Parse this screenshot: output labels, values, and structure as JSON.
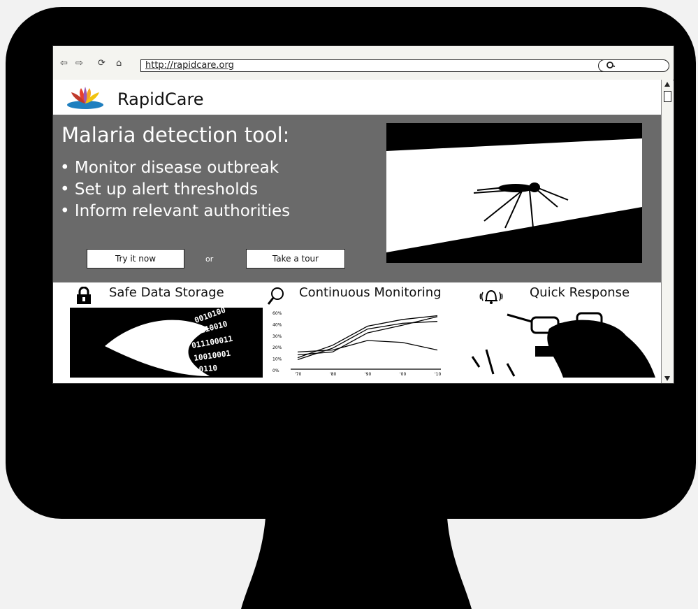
{
  "browser": {
    "url": "http://rapidcare.org",
    "nav_back": "⇦",
    "nav_forward": "⇨",
    "nav_reload": "⟳",
    "nav_home": "⌂"
  },
  "site": {
    "brand": "RapidCare"
  },
  "hero": {
    "title": "Malaria detection tool:",
    "bullets": [
      "• Monitor disease outbreak",
      "• Set up alert thresholds",
      "• Inform relevant authorities"
    ],
    "try_button": "Try it now",
    "or_text": "or",
    "tour_button": "Take a tour"
  },
  "features": [
    {
      "label": "Safe Data Storage",
      "icon": "lock-icon"
    },
    {
      "label": "Continuous Monitoring",
      "icon": "magnifier-icon"
    },
    {
      "label": "Quick Response",
      "icon": "bell-icon"
    }
  ],
  "chart_data": {
    "type": "line",
    "x": [
      1970,
      1980,
      1990,
      2000,
      2010
    ],
    "x_ticks": [
      "'70",
      "'80",
      "'90",
      "'00",
      "'10"
    ],
    "y_ticks": [
      "60%",
      "40%",
      "30%",
      "20%",
      "10%",
      "0%"
    ],
    "ylim": [
      0,
      60
    ],
    "series": [
      {
        "values": [
          15,
          18,
          38,
          46,
          55
        ]
      },
      {
        "values": [
          12,
          25,
          45,
          52,
          56
        ]
      },
      {
        "values": [
          10,
          22,
          42,
          48,
          50
        ]
      },
      {
        "values": [
          18,
          20,
          30,
          28,
          20
        ]
      }
    ]
  }
}
